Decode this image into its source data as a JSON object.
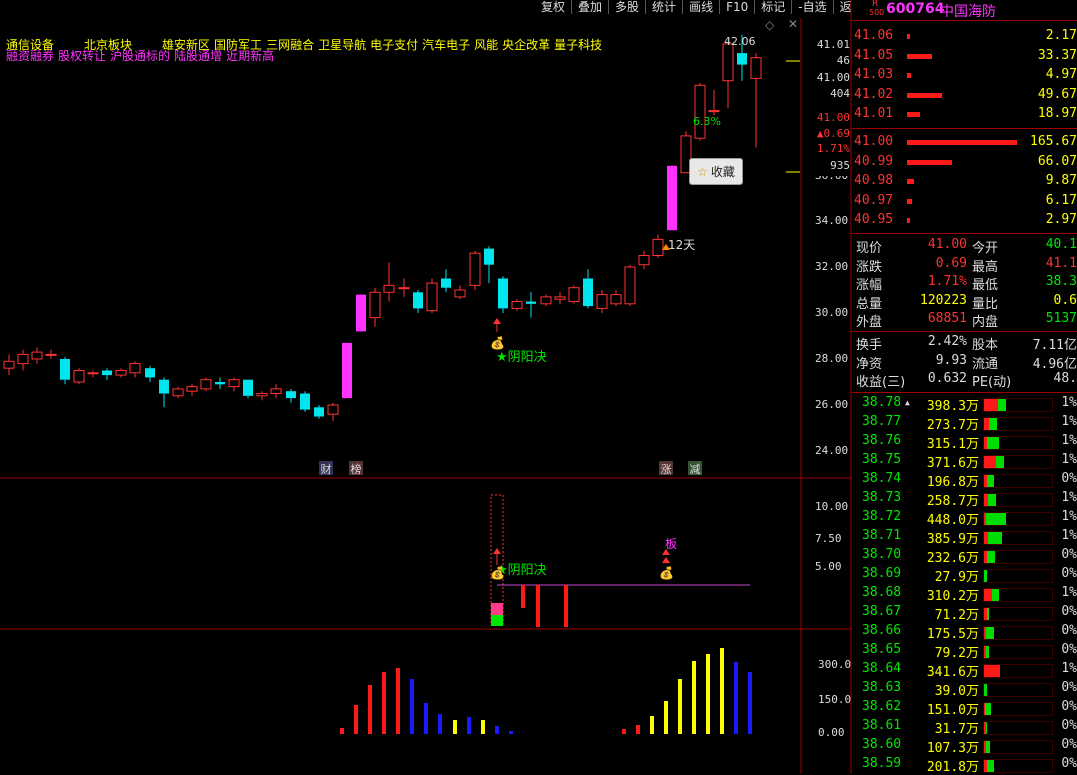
{
  "menu": [
    "复权",
    "叠加",
    "多股",
    "统计",
    "画线",
    "F10",
    "标记",
    "-自选",
    "返回"
  ],
  "concepts_line1": [
    "通信设备",
    "北京板块",
    "雄安新区",
    "国防军工",
    "三网融合",
    "卫星导航",
    "电子支付",
    "汽车电子",
    "风能",
    "央企改革",
    "量子科技"
  ],
  "concepts_line2": [
    "融资融券",
    "股权转让",
    "沪股通标的",
    "陆股通增",
    "近期新高"
  ],
  "stock": {
    "badge_top": "R",
    "badge_bottom": "500",
    "code": "600764",
    "name": "中国海防"
  },
  "axis_main": [
    "24.00",
    "26.00",
    "28.00",
    "30.00",
    "32.00",
    "34.00",
    "36.00"
  ],
  "axis_top_box": [
    "41.01",
    "46",
    "41.00",
    "404",
    "41.00",
    "▲0.69",
    "1.71%",
    "935"
  ],
  "axis_mid": [
    "10.00",
    "7.50",
    "5.00"
  ],
  "axis_bot": [
    "300.0",
    "150.0",
    "0.00"
  ],
  "annotations": {
    "high_label": "42.06",
    "pct_label": "6.3%",
    "days_label": "12天",
    "yinyang1": "阴阳决",
    "yinyang2": "阴阳决",
    "ban": "板",
    "cai": "财",
    "bang": "榜",
    "zhang": "涨",
    "jian": "减",
    "fav": "收藏"
  },
  "asks": [
    {
      "price": "41.06",
      "vol": "2.17",
      "bar": 3
    },
    {
      "price": "41.05",
      "vol": "33.37",
      "bar": 25
    },
    {
      "price": "41.03",
      "vol": "4.97",
      "bar": 4
    },
    {
      "price": "41.02",
      "vol": "49.67",
      "bar": 35
    },
    {
      "price": "41.01",
      "vol": "18.97",
      "bar": 13
    }
  ],
  "bids": [
    {
      "price": "41.00",
      "vol": "165.67",
      "bar": 110
    },
    {
      "price": "40.99",
      "vol": "66.07",
      "bar": 45
    },
    {
      "price": "40.98",
      "vol": "9.87",
      "bar": 7
    },
    {
      "price": "40.97",
      "vol": "6.17",
      "bar": 5
    },
    {
      "price": "40.95",
      "vol": "2.97",
      "bar": 3
    }
  ],
  "quote": [
    {
      "l1": "现价",
      "v1": "41.00",
      "c1": "red",
      "l2": "今开",
      "v2": "40.1",
      "c2": "green"
    },
    {
      "l1": "涨跌",
      "v1": "0.69",
      "c1": "red",
      "l2": "最高",
      "v2": "41.1",
      "c2": "red"
    },
    {
      "l1": "涨幅",
      "v1": "1.71%",
      "c1": "red",
      "l2": "最低",
      "v2": "38.3",
      "c2": "green"
    },
    {
      "l1": "总量",
      "v1": "120223",
      "c1": "yellow",
      "l2": "量比",
      "v2": "0.6",
      "c2": "yellow"
    },
    {
      "l1": "外盘",
      "v1": "68851",
      "c1": "red",
      "l2": "内盘",
      "v2": "5137",
      "c2": "green"
    }
  ],
  "fund": [
    {
      "l1": "换手",
      "v1": "2.42%",
      "l2": "股本",
      "v2": "7.11亿"
    },
    {
      "l1": "净资",
      "v1": "9.93",
      "l2": "流通",
      "v2": "4.96亿"
    },
    {
      "l1": "收益(三)",
      "v1": "0.632",
      "l2": "PE(动)",
      "v2": "48."
    }
  ],
  "ticks": [
    {
      "price": "38.78",
      "vol": "398.3万",
      "pct": "1%",
      "r": 14,
      "g": 8
    },
    {
      "price": "38.77",
      "vol": "273.7万",
      "pct": "1%",
      "r": 5,
      "g": 8
    },
    {
      "price": "38.76",
      "vol": "315.1万",
      "pct": "1%",
      "r": 3,
      "g": 12
    },
    {
      "price": "38.75",
      "vol": "371.6万",
      "pct": "1%",
      "r": 12,
      "g": 8
    },
    {
      "price": "38.74",
      "vol": "196.8万",
      "pct": "0%",
      "r": 3,
      "g": 7
    },
    {
      "price": "38.73",
      "vol": "258.7万",
      "pct": "1%",
      "r": 4,
      "g": 8
    },
    {
      "price": "38.72",
      "vol": "448.0万",
      "pct": "1%",
      "r": 2,
      "g": 20
    },
    {
      "price": "38.71",
      "vol": "385.9万",
      "pct": "1%",
      "r": 4,
      "g": 14
    },
    {
      "price": "38.70",
      "vol": "232.6万",
      "pct": "0%",
      "r": 3,
      "g": 8
    },
    {
      "price": "38.69",
      "vol": "27.9万",
      "pct": "0%",
      "r": 0,
      "g": 3
    },
    {
      "price": "38.68",
      "vol": "310.2万",
      "pct": "1%",
      "r": 8,
      "g": 7
    },
    {
      "price": "38.67",
      "vol": "71.2万",
      "pct": "0%",
      "r": 3,
      "g": 2
    },
    {
      "price": "38.66",
      "vol": "175.5万",
      "pct": "0%",
      "r": 2,
      "g": 8
    },
    {
      "price": "38.65",
      "vol": "79.2万",
      "pct": "0%",
      "r": 2,
      "g": 3
    },
    {
      "price": "38.64",
      "vol": "341.6万",
      "pct": "1%",
      "r": 16,
      "g": 0
    },
    {
      "price": "38.63",
      "vol": "39.0万",
      "pct": "0%",
      "r": 0,
      "g": 3
    },
    {
      "price": "38.62",
      "vol": "151.0万",
      "pct": "0%",
      "r": 1,
      "g": 6
    },
    {
      "price": "38.61",
      "vol": "31.7万",
      "pct": "0%",
      "r": 2,
      "g": 1
    },
    {
      "price": "38.60",
      "vol": "107.3万",
      "pct": "0%",
      "r": 2,
      "g": 4
    },
    {
      "price": "38.59",
      "vol": "201.8万",
      "pct": "0%",
      "r": 3,
      "g": 7
    }
  ]
}
